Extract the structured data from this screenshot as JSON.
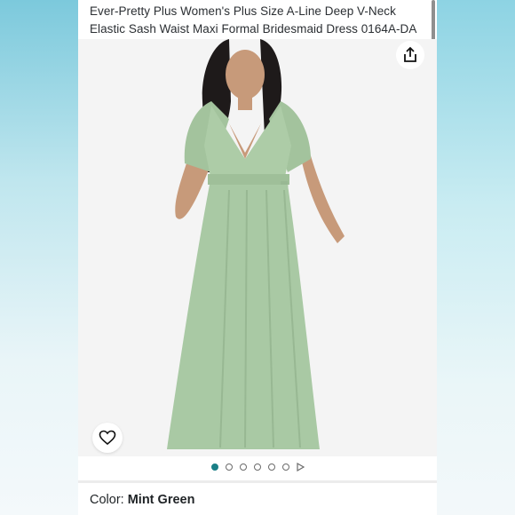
{
  "product": {
    "title": "Ever-Pretty Plus Women's Plus Size A-Line Deep V-Neck Elastic Sash Waist Maxi Formal Bridesmaid Dress 0164A-DA"
  },
  "gallery": {
    "image_count": 6,
    "active_index": 0,
    "has_video": true,
    "share_icon": "share-icon",
    "wishlist_icon": "heart-icon"
  },
  "color": {
    "label": "Color:",
    "value": "Mint Green"
  },
  "colors": {
    "dress": "#a9c9a4",
    "accent": "#1a7f86"
  }
}
